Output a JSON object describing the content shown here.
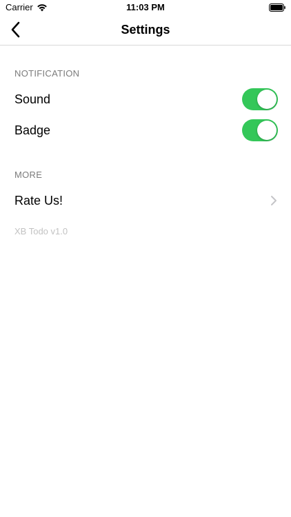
{
  "status_bar": {
    "carrier": "Carrier",
    "time": "11:03 PM"
  },
  "nav": {
    "title": "Settings"
  },
  "sections": {
    "notification": {
      "header": "NOTIFICATION",
      "sound_label": "Sound",
      "sound_on": true,
      "badge_label": "Badge",
      "badge_on": true
    },
    "more": {
      "header": "MORE",
      "rate_label": "Rate Us!"
    }
  },
  "footer": {
    "version": "XB Todo v1.0"
  },
  "colors": {
    "toggle_on": "#34c759",
    "section_header": "#7b7b7b",
    "version_text": "#c2c2c2"
  },
  "icons": {
    "back": "chevron-left-icon",
    "wifi": "wifi-icon",
    "battery": "battery-icon",
    "disclosure": "chevron-right-icon"
  }
}
